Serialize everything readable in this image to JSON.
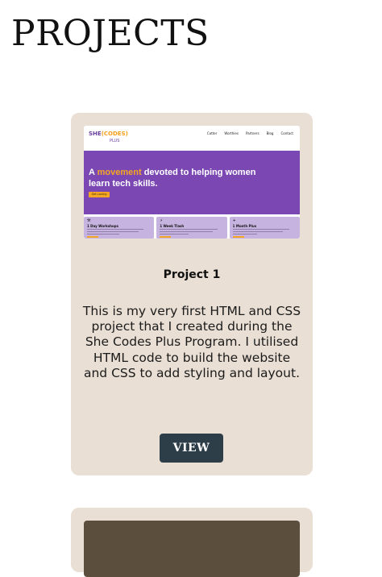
{
  "page": {
    "heading": "PROJECTS"
  },
  "projects": [
    {
      "title": "Project 1",
      "description": "This is my very first HTML and CSS project that I created during the She Codes Plus Program. I utilised HTML code to build the website and CSS to add styling and layout.",
      "button_label": "VIEW",
      "thumbnail": {
        "logo_she": "SHE",
        "logo_codes": "(CODES)",
        "logo_plus": "PLUS",
        "nav_links": [
          "Cotter",
          "Worthies",
          "Partners",
          "Blog",
          "Contact"
        ],
        "hero_prefix": "A",
        "hero_accent": "movement",
        "hero_rest": "devoted to helping women learn tech skills.",
        "hero_button": "Get Loving",
        "features": [
          {
            "icon": "⚒",
            "title": "1 Day Workshops"
          },
          {
            "icon": "⚡",
            "title": "1 Week Tlash"
          },
          {
            "icon": "+",
            "title": "1 Month Plus"
          }
        ],
        "colors": {
          "hero": "#7b47b3",
          "accent": "#f5a623",
          "feature_card": "#c7b3e0"
        }
      }
    },
    {
      "thumbnail": {
        "colors": {
          "background": "#5c4e3c"
        }
      }
    }
  ],
  "colors": {
    "card_background": "#e9dfd4",
    "button_background": "#2d3e48",
    "button_text": "#ffffff"
  }
}
